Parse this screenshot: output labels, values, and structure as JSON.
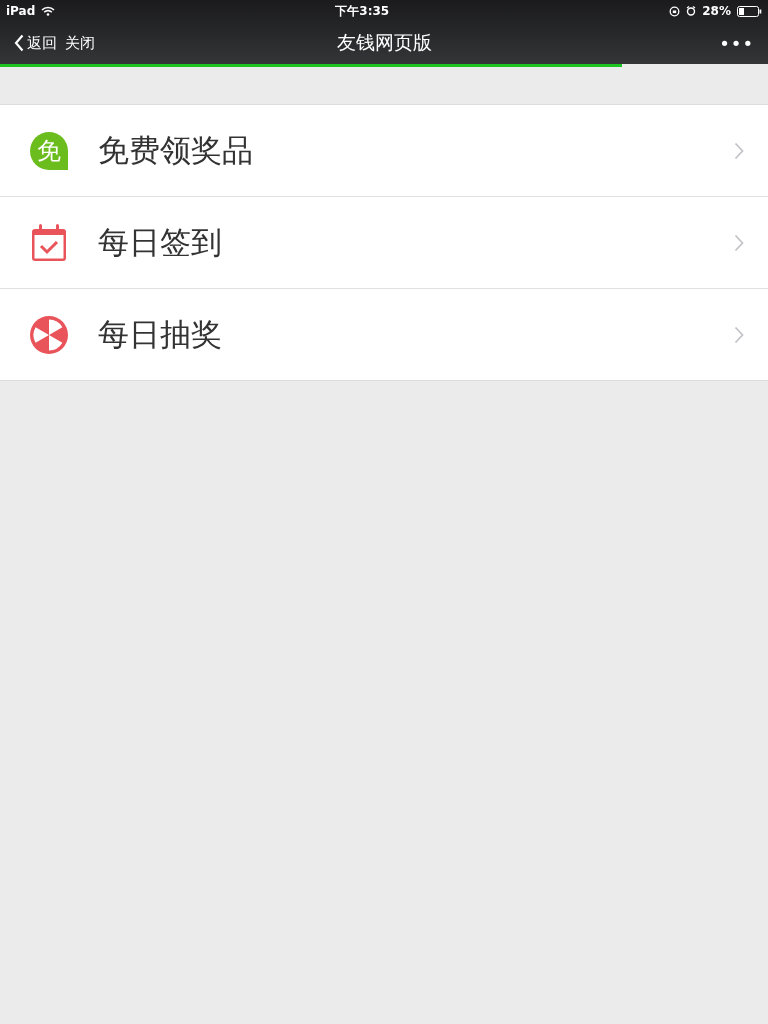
{
  "status_bar": {
    "device": "iPad",
    "time": "下午3:35",
    "battery": "28%"
  },
  "nav": {
    "back": "返回",
    "close": "关闭",
    "title": "友钱网页版",
    "more": "•••"
  },
  "progress": {
    "level": 0.81
  },
  "items": [
    {
      "kind": "free",
      "icon_text": "免",
      "label": "免费领奖品"
    },
    {
      "kind": "checkin",
      "label": "每日签到"
    },
    {
      "kind": "lottery",
      "label": "每日抽奖"
    }
  ]
}
